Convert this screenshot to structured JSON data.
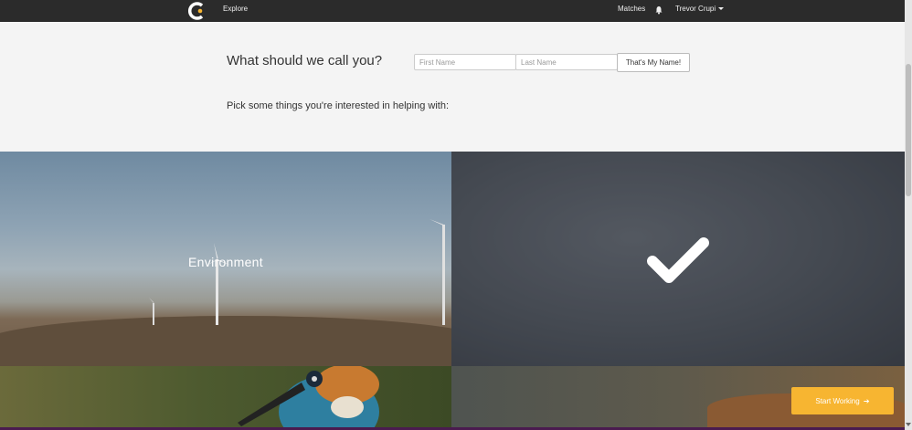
{
  "nav": {
    "explore": "Explore",
    "matches": "Matches",
    "user_name": "Trevor Crupi"
  },
  "form": {
    "question": "What should we call you?",
    "first_name_placeholder": "First Name",
    "last_name_placeholder": "Last Name",
    "first_name_value": "",
    "last_name_value": "",
    "submit_label": "That's My Name!"
  },
  "interests": {
    "heading": "Pick some things you're interested in helping with:",
    "tiles": [
      {
        "label": "Environment",
        "selected": false
      },
      {
        "label": "",
        "selected": true,
        "icon": "check-icon"
      },
      {
        "label": "",
        "selected": false
      },
      {
        "label": "",
        "selected": false
      }
    ]
  },
  "actions": {
    "start_label": "Start Working",
    "start_icon": "arrow-right-icon"
  },
  "colors": {
    "navbar": "#2b2b2b",
    "accent": "#f7b531",
    "bottom_bar": "#4a1b4f"
  }
}
